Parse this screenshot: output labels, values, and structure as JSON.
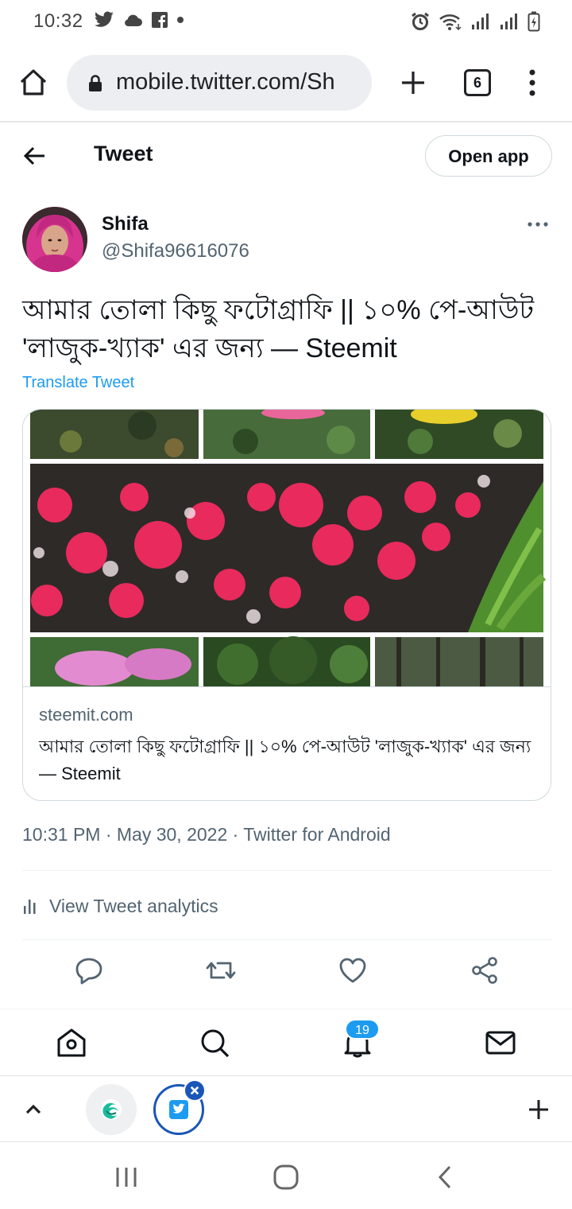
{
  "status_bar": {
    "time": "10:32",
    "left_icons": [
      "twitter-icon",
      "cloud-icon",
      "facebook-icon",
      "dot-icon"
    ],
    "right_icons": [
      "alarm-icon",
      "wifi-icon",
      "signal-icon",
      "signal-icon",
      "battery-charging-icon"
    ]
  },
  "browser": {
    "url": "mobile.twitter.com/Sh",
    "tab_count": "6"
  },
  "header": {
    "title": "Tweet",
    "open_app_label": "Open app"
  },
  "tweet": {
    "author_name": "Shifa",
    "author_handle": "@Shifa96616076",
    "text": "আমার তোলা কিছু ফটোগ্রাফি || ১০% পে-আউট 'লাজুক-খ্যাক' এর জন্য — Steemit",
    "translate_label": "Translate Tweet",
    "card": {
      "domain": "steemit.com",
      "title": "আমার তোলা কিছু ফটোগ্রাফি || ১০% পে-আউট 'লাজুক-খ্যাক' এর জন্য — Steemit"
    },
    "timestamp": "10:31 PM · May 30, 2022 · Twitter for Android",
    "analytics_label": "View Tweet analytics"
  },
  "nav": {
    "notification_count": "19"
  },
  "colors": {
    "accent": "#1d9bf0",
    "secondary_text": "#536471",
    "border": "#cfd9de",
    "chrome_blue": "#1a56b8"
  }
}
